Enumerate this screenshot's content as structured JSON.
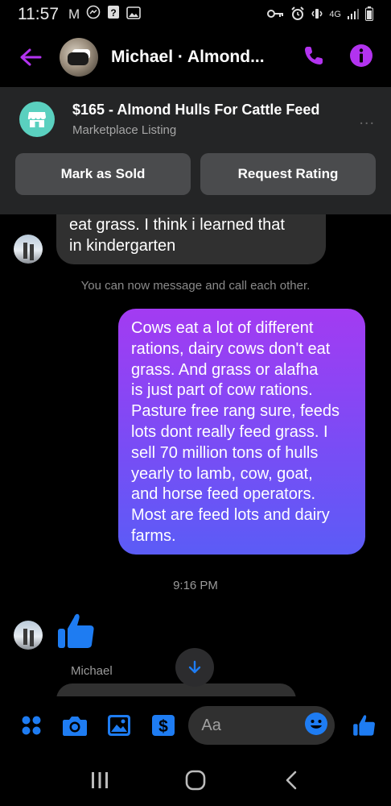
{
  "status_bar": {
    "time": "11:57",
    "network": "4G"
  },
  "header": {
    "contact_name": "Michael · Almond..."
  },
  "listing": {
    "title": "$165 - Almond Hulls For Cattle Feed",
    "subtitle": "Marketplace Listing",
    "more": "...",
    "mark_sold_label": "Mark as Sold",
    "request_rating_label": "Request Rating"
  },
  "thread": {
    "incoming_message_partial": "eat grass. I think i learned that in kindergarten",
    "incoming_message_lines": [
      "eat grass. I think i learned that",
      "in kindergarten"
    ],
    "system_notice": "You can now message and call each other.",
    "outgoing_message": "Cows eat a lot of different rations,  dairy cows don't eat grass.  And grass or alafha is just part of cow rations.  Pasture free rang sure, feeds lots dont really feed grass.  I sell 70 million tons of hulls yearly to lamb, cow, goat, and horse feed operators.  Most are feed lots and dairy farms.",
    "outgoing_message_lines": [
      "Cows eat a lot of different",
      "rations,  dairy cows don't eat",
      "grass.  And grass or alafha",
      "is just part of cow rations.",
      "Pasture free rang sure, feeds",
      "lots dont really feed grass.  I",
      "sell 70 million tons of hulls",
      "yearly to lamb, cow, goat,",
      "and horse feed operators.",
      "Most are feed lots and dairy",
      "farms."
    ],
    "timestamp": "9:16 PM",
    "sender_name": "Michael"
  },
  "composer": {
    "placeholder": "Aa"
  },
  "colors": {
    "accent_purple": "#b233ef",
    "accent_blue": "#1e7cf2",
    "bubble_incoming": "#303030",
    "bubble_out_top": "#a33bf2",
    "bubble_out_bottom": "#5b5cf6",
    "listing_badge": "#5ad0bf"
  },
  "icons": [
    "back-arrow-icon",
    "phone-icon",
    "info-icon",
    "store-icon",
    "thumbs-up-icon",
    "arrow-down-icon",
    "apps-icon",
    "camera-icon",
    "image-icon",
    "dollar-icon",
    "emoji-icon",
    "recents-icon",
    "home-icon",
    "nav-back-icon"
  ]
}
